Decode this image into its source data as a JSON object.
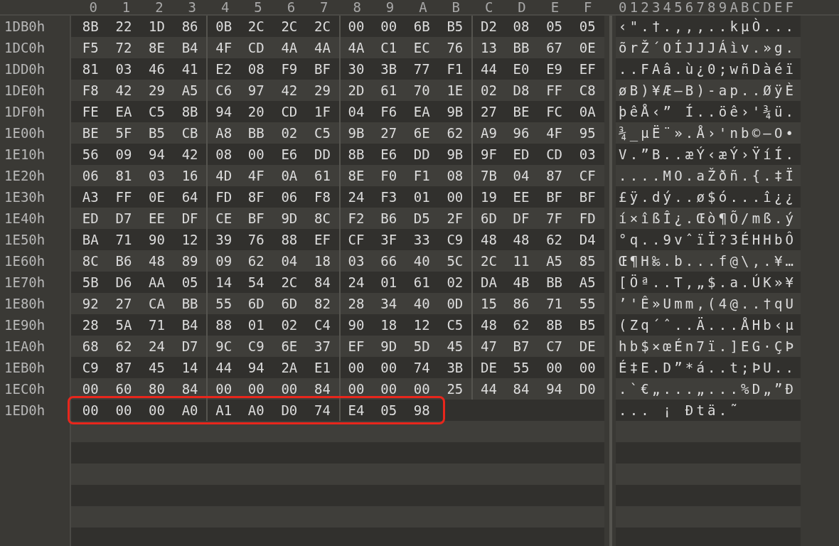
{
  "column_headers": [
    "0",
    "1",
    "2",
    "3",
    "4",
    "5",
    "6",
    "7",
    "8",
    "9",
    "A",
    "B",
    "C",
    "D",
    "E",
    "F"
  ],
  "ascii_header": "0123456789ABCDEF",
  "rows": [
    {
      "address": "1DB0h",
      "bytes": [
        "8B",
        "22",
        "1D",
        "86",
        "0B",
        "2C",
        "2C",
        "2C",
        "00",
        "00",
        "6B",
        "B5",
        "D2",
        "08",
        "05",
        "05"
      ],
      "ascii": "‹\".†.,,,..kµÒ...",
      "highlighted": false
    },
    {
      "address": "1DC0h",
      "bytes": [
        "F5",
        "72",
        "8E",
        "B4",
        "4F",
        "CD",
        "4A",
        "4A",
        "4A",
        "C1",
        "EC",
        "76",
        "13",
        "BB",
        "67",
        "0E"
      ],
      "ascii": "õrŽ´OÍJJJÁìv.»g.",
      "highlighted": false
    },
    {
      "address": "1DD0h",
      "bytes": [
        "81",
        "03",
        "46",
        "41",
        "E2",
        "08",
        "F9",
        "BF",
        "30",
        "3B",
        "77",
        "F1",
        "44",
        "E0",
        "E9",
        "EF"
      ],
      "ascii": "..FAâ.ù¿0;wñDàéï",
      "highlighted": false
    },
    {
      "address": "1DE0h",
      "bytes": [
        "F8",
        "42",
        "29",
        "A5",
        "C6",
        "97",
        "42",
        "29",
        "2D",
        "61",
        "70",
        "1E",
        "02",
        "D8",
        "FF",
        "C8"
      ],
      "ascii": "øB)¥Æ—B)-ap..ØÿÈ",
      "highlighted": false
    },
    {
      "address": "1DF0h",
      "bytes": [
        "FE",
        "EA",
        "C5",
        "8B",
        "94",
        "20",
        "CD",
        "1F",
        "04",
        "F6",
        "EA",
        "9B",
        "27",
        "BE",
        "FC",
        "0A"
      ],
      "ascii": "þêÅ‹” Í..öê›'¾ü.",
      "highlighted": false
    },
    {
      "address": "1E00h",
      "bytes": [
        "BE",
        "5F",
        "B5",
        "CB",
        "A8",
        "BB",
        "02",
        "C5",
        "9B",
        "27",
        "6E",
        "62",
        "A9",
        "96",
        "4F",
        "95"
      ],
      "ascii": "¾_µË¨».Å›'nb©–O•",
      "highlighted": false
    },
    {
      "address": "1E10h",
      "bytes": [
        "56",
        "09",
        "94",
        "42",
        "08",
        "00",
        "E6",
        "DD",
        "8B",
        "E6",
        "DD",
        "9B",
        "9F",
        "ED",
        "CD",
        "03"
      ],
      "ascii": "V.”B..æÝ‹æÝ›ŸíÍ.",
      "highlighted": false
    },
    {
      "address": "1E20h",
      "bytes": [
        "06",
        "81",
        "03",
        "16",
        "4D",
        "4F",
        "0A",
        "61",
        "8E",
        "F0",
        "F1",
        "08",
        "7B",
        "04",
        "87",
        "CF"
      ],
      "ascii": "....MO.aŽðñ.{.‡Ï",
      "highlighted": false
    },
    {
      "address": "1E30h",
      "bytes": [
        "A3",
        "FF",
        "0E",
        "64",
        "FD",
        "8F",
        "06",
        "F8",
        "24",
        "F3",
        "01",
        "00",
        "19",
        "EE",
        "BF",
        "BF"
      ],
      "ascii": "£ÿ.dý..ø$ó...î¿¿",
      "highlighted": false
    },
    {
      "address": "1E40h",
      "bytes": [
        "ED",
        "D7",
        "EE",
        "DF",
        "CE",
        "BF",
        "9D",
        "8C",
        "F2",
        "B6",
        "D5",
        "2F",
        "6D",
        "DF",
        "7F",
        "FD"
      ],
      "ascii": "í×îßÎ¿.Œò¶Õ/mß.ý",
      "highlighted": false
    },
    {
      "address": "1E50h",
      "bytes": [
        "BA",
        "71",
        "90",
        "12",
        "39",
        "76",
        "88",
        "EF",
        "CF",
        "3F",
        "33",
        "C9",
        "48",
        "48",
        "62",
        "D4"
      ],
      "ascii": "°q..9vˆïÏ?3ÉHHbÔ",
      "highlighted": false
    },
    {
      "address": "1E60h",
      "bytes": [
        "8C",
        "B6",
        "48",
        "89",
        "09",
        "62",
        "04",
        "18",
        "03",
        "66",
        "40",
        "5C",
        "2C",
        "11",
        "A5",
        "85"
      ],
      "ascii": "Œ¶H‰.b...f@\\,.¥…",
      "highlighted": false
    },
    {
      "address": "1E70h",
      "bytes": [
        "5B",
        "D6",
        "AA",
        "05",
        "14",
        "54",
        "2C",
        "84",
        "24",
        "01",
        "61",
        "02",
        "DA",
        "4B",
        "BB",
        "A5"
      ],
      "ascii": "[Öª..T,„$.a.ÚK»¥",
      "highlighted": false
    },
    {
      "address": "1E80h",
      "bytes": [
        "92",
        "27",
        "CA",
        "BB",
        "55",
        "6D",
        "6D",
        "82",
        "28",
        "34",
        "40",
        "0D",
        "15",
        "86",
        "71",
        "55"
      ],
      "ascii": "’'Ê»Umm‚(4@..†qU",
      "highlighted": false
    },
    {
      "address": "1E90h",
      "bytes": [
        "28",
        "5A",
        "71",
        "B4",
        "88",
        "01",
        "02",
        "C4",
        "90",
        "18",
        "12",
        "C5",
        "48",
        "62",
        "8B",
        "B5"
      ],
      "ascii": "(Zq´ˆ..Ä...ÅHb‹µ",
      "highlighted": false
    },
    {
      "address": "1EA0h",
      "bytes": [
        "68",
        "62",
        "24",
        "D7",
        "9C",
        "C9",
        "6E",
        "37",
        "EF",
        "9D",
        "5D",
        "45",
        "47",
        "B7",
        "C7",
        "DE"
      ],
      "ascii": "hb$×œÉn7ï.]EG·ÇÞ",
      "highlighted": false
    },
    {
      "address": "1EB0h",
      "bytes": [
        "C9",
        "87",
        "45",
        "14",
        "44",
        "94",
        "2A",
        "E1",
        "00",
        "00",
        "74",
        "3B",
        "DE",
        "55",
        "00",
        "00"
      ],
      "ascii": "É‡E.D”*á..t;ÞU..",
      "highlighted": false
    },
    {
      "address": "1EC0h",
      "bytes": [
        "00",
        "60",
        "80",
        "84",
        "00",
        "00",
        "00",
        "84",
        "00",
        "00",
        "00",
        "25",
        "44",
        "84",
        "94",
        "D0"
      ],
      "ascii": ".`€„...„...%D„”Ð",
      "highlighted": false
    },
    {
      "address": "1ED0h",
      "bytes": [
        "00",
        "00",
        "00",
        "A0",
        "A1",
        "A0",
        "D0",
        "74",
        "E4",
        "05",
        "98"
      ],
      "ascii": "... ¡ Ðtä.˜",
      "highlighted": true
    }
  ]
}
